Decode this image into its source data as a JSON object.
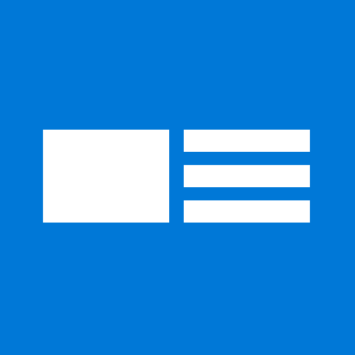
{
  "app_tile": {
    "background_color": "#0078d7",
    "glyph_color": "#ffffff",
    "icon": "news-article-icon",
    "glyph_parts": [
      "image-block",
      "text-line",
      "text-line",
      "text-line"
    ]
  }
}
